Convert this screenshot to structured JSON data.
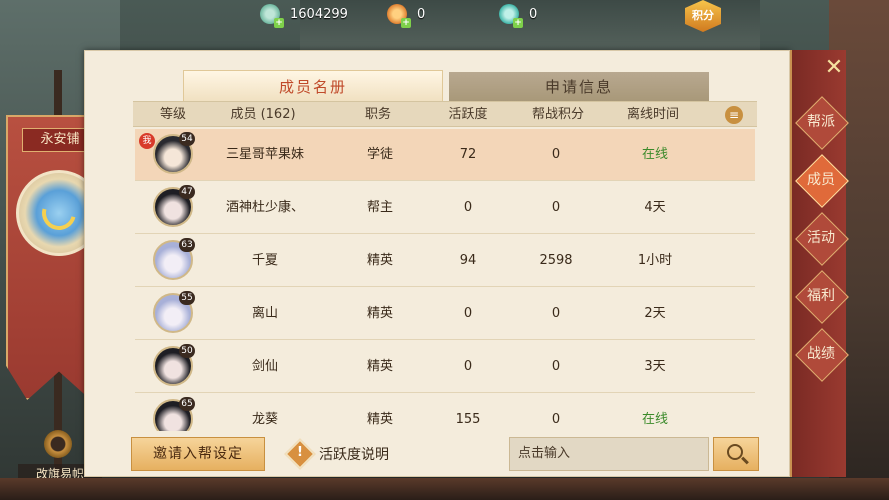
{
  "currency": [
    {
      "icon": "jade-coin-icon",
      "value": "1604299"
    },
    {
      "icon": "gold-coin-icon",
      "value": "0"
    },
    {
      "icon": "teal-coin-icon",
      "value": "0"
    }
  ],
  "points_badge": "积分",
  "banner": {
    "title": "永安铺",
    "action": "改旗易帜"
  },
  "tabs": {
    "roster": "成员名册",
    "apply": "申请信息"
  },
  "table": {
    "headers": [
      "等级",
      "成员 (162)",
      "职务",
      "活跃度",
      "帮战积分",
      "离线时间"
    ],
    "rows": [
      {
        "level": "54",
        "name": "三星哥苹果妹",
        "role": "学徒",
        "activity": "72",
        "war_points": "0",
        "offline": "在线",
        "me": "我"
      },
      {
        "level": "47",
        "name": "酒神杜少康、",
        "role": "帮主",
        "activity": "0",
        "war_points": "0",
        "offline": "4天"
      },
      {
        "level": "63",
        "name": "千夏",
        "role": "精英",
        "activity": "94",
        "war_points": "2598",
        "offline": "1小时"
      },
      {
        "level": "55",
        "name": "离山",
        "role": "精英",
        "activity": "0",
        "war_points": "0",
        "offline": "2天"
      },
      {
        "level": "50",
        "name": "剑仙",
        "role": "精英",
        "activity": "0",
        "war_points": "0",
        "offline": "3天"
      },
      {
        "level": "65",
        "name": "龙葵",
        "role": "精英",
        "activity": "155",
        "war_points": "0",
        "offline": "在线"
      }
    ]
  },
  "bottom": {
    "invite_label": "邀请入帮设定",
    "activity_help": "活跃度说明",
    "search_placeholder": "点击输入"
  },
  "sidenav": [
    "帮派",
    "成员",
    "活动",
    "福利",
    "战绩"
  ],
  "colors": {
    "accent": "#c04a2a",
    "online": "#3a8a2a",
    "selected_row": "#f3d6b8"
  }
}
